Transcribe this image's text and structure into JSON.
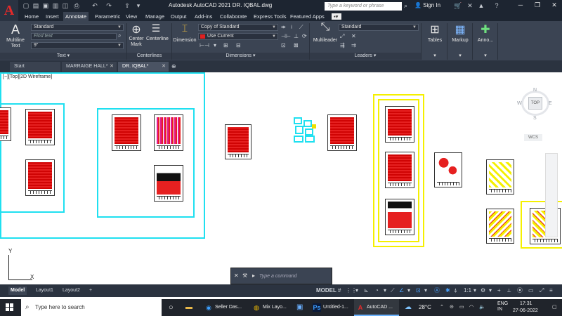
{
  "app": {
    "title": "Autodesk AutoCAD 2021   DR. IQBAL.dwg",
    "logo_letter": "A",
    "search_placeholder": "Type a keyword or phrase",
    "sign_in": "Sign In"
  },
  "ribbon_tabs": [
    "Home",
    "Insert",
    "Annotate",
    "Parametric",
    "View",
    "Manage",
    "Output",
    "Add-ins",
    "Collaborate",
    "Express Tools",
    "Featured Apps"
  ],
  "ribbon": {
    "text_panel": {
      "title": "Text",
      "multiline_text": "Multiline\nText",
      "style_value": "Standard",
      "find_placeholder": "Find text",
      "height_value": "9\""
    },
    "centerlines_panel": {
      "title": "Centerlines",
      "center_mark": "Center\nMark",
      "centerline": "Centerline"
    },
    "dimensions_panel": {
      "title": "Dimensions",
      "dimension": "Dimension",
      "dimstyle_value": "Copy of Standard",
      "layer_value": "Use Current"
    },
    "leaders_panel": {
      "title": "Leaders",
      "multileader": "Multileader",
      "leader_style": "Standard"
    },
    "tables_label": "Tables",
    "markup_label": "Markup",
    "annotation_label": "Anno..."
  },
  "doc_tabs": {
    "start": "Start",
    "tab1": "MARRAIGE HALL*",
    "tab2": "DR. IQBAL*"
  },
  "viewport_label": "[−][Top][2D Wireframe]",
  "viewcube": {
    "top": "TOP",
    "n": "N",
    "s": "S",
    "e": "E",
    "w": "W",
    "wcs": "WCS"
  },
  "ucs": {
    "y": "Y",
    "x": "X"
  },
  "command": {
    "placeholder": "Type a command"
  },
  "layout_tabs": [
    "Model",
    "Layout1",
    "Layout2"
  ],
  "status": {
    "model": "MODEL",
    "scale": "1:1"
  },
  "taskbar": {
    "search": "Type here to search",
    "apps": [
      "Seller Das...",
      "Mix Layo...",
      "Untitled-1...",
      "AutoCAD ..."
    ],
    "temperature": "28°C",
    "lang": "ENG\nIN",
    "time": "17:31",
    "date": "27-06-2022"
  },
  "colors": {
    "accent_red": "#e62020",
    "cyan_frame": "#1fe0f0",
    "yellow_frame": "#f5f000"
  }
}
